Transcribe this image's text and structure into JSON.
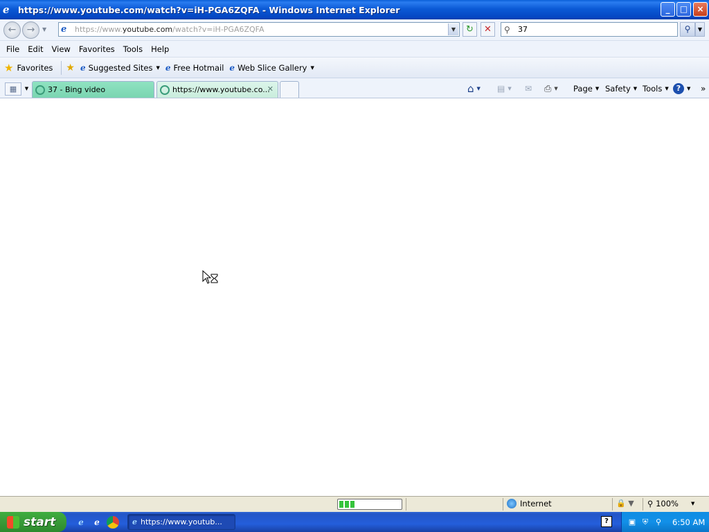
{
  "window": {
    "title": "https://www.youtube.com/watch?v=iH-PGA6ZQFA - Windows Internet Explorer",
    "controls": {
      "minimize": "_",
      "maximize": "□",
      "close": "×"
    }
  },
  "address_bar": {
    "url_prefix": "https://www.",
    "url_domain": "youtube.com",
    "url_path": "/watch?v=iH-PGA6ZQFA",
    "search_value": "37"
  },
  "menu": [
    "File",
    "Edit",
    "View",
    "Favorites",
    "Tools",
    "Help"
  ],
  "favorites_bar": {
    "favorites_label": "Favorites",
    "links": [
      "Suggested Sites",
      "Free Hotmail",
      "Web Slice Gallery"
    ]
  },
  "tabs": [
    {
      "label": "37 - Bing video"
    },
    {
      "label": "https://www.youtube.co..."
    }
  ],
  "command_bar": {
    "page": "Page",
    "safety": "Safety",
    "tools": "Tools"
  },
  "status_bar": {
    "progress_blocks": 3,
    "zone": "Internet",
    "zoom": "100%"
  },
  "taskbar": {
    "start_label": "start",
    "task_item": "https://www.youtub...",
    "clock": "6:50 AM"
  },
  "colors": {
    "titlebar": "#0b5ad6",
    "tab_bing": "#7ad5b1",
    "tab_active": "#c9eddc",
    "taskbar": "#245edb",
    "start": "#389a38"
  }
}
